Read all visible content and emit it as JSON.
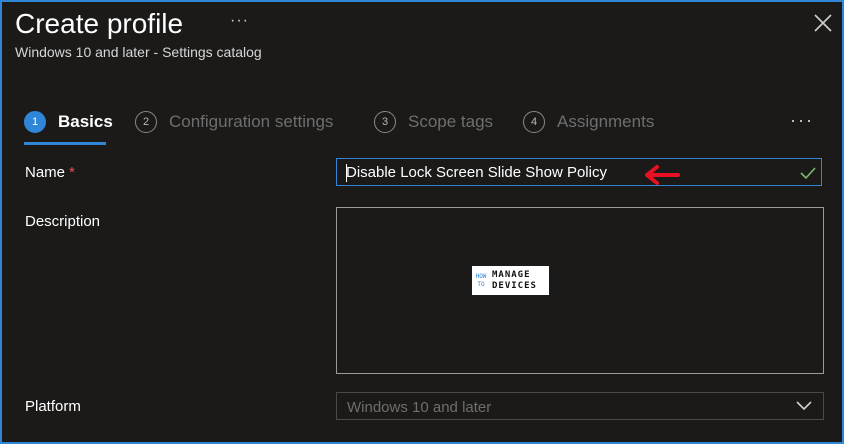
{
  "header": {
    "title": "Create profile",
    "more": "···",
    "subtitle": "Windows 10 and later - Settings catalog"
  },
  "tabs": [
    {
      "num": "1",
      "label": "Basics",
      "active": true
    },
    {
      "num": "2",
      "label": "Configuration settings",
      "active": false
    },
    {
      "num": "3",
      "label": "Scope tags",
      "active": false
    },
    {
      "num": "4",
      "label": "Assignments",
      "active": false
    }
  ],
  "tabs_more": "···",
  "form": {
    "name": {
      "label": "Name",
      "required_mark": "*",
      "value": "Disable Lock Screen Slide Show Policy"
    },
    "description": {
      "label": "Description",
      "value": ""
    },
    "platform": {
      "label": "Platform",
      "value": "Windows 10 and later"
    }
  },
  "watermark": {
    "left": "HOW TO",
    "right_top": "MANAGE",
    "right_bottom": "DEVICES"
  },
  "colors": {
    "accent": "#2f86d6",
    "background": "#1b1a19",
    "required": "#e35151",
    "check": "#7fba6b",
    "annotation_arrow": "#e81123"
  },
  "icons": {
    "close": "close-icon",
    "check": "checkmark-icon",
    "dropdown": "chevron-down-icon",
    "annotation": "red-arrow-icon"
  }
}
